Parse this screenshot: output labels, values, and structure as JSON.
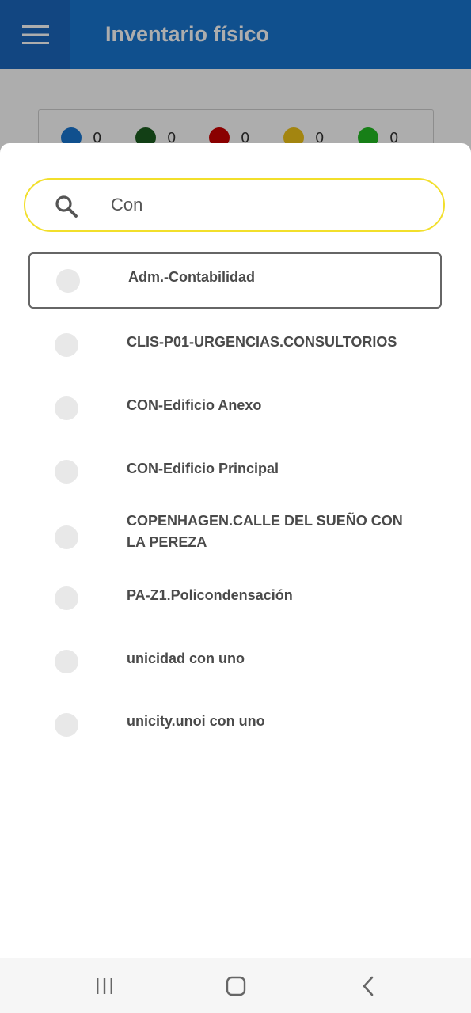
{
  "app_bar": {
    "title": "Inventario físico",
    "menu_icon": "hamburger-menu-icon",
    "color": "#1976d2"
  },
  "status_summary": [
    {
      "color": "#1976d2",
      "count": "0"
    },
    {
      "color": "#1b5e20",
      "count": "0"
    },
    {
      "color": "#cc0000",
      "count": "0"
    },
    {
      "color": "#f0c419",
      "count": "0"
    },
    {
      "color": "#22bb22",
      "count": "0"
    }
  ],
  "search": {
    "value": "Con",
    "icon": "search-icon",
    "border_color": "#f2df2b"
  },
  "locations": [
    {
      "label": "Adm.-Contabilidad",
      "selected": true
    },
    {
      "label": "CLIS-P01-URGENCIAS.CONSULTORIOS",
      "selected": false
    },
    {
      "label": "CON-Edificio Anexo",
      "selected": false
    },
    {
      "label": "CON-Edificio Principal",
      "selected": false
    },
    {
      "label": "COPENHAGEN.CALLE DEL SUEÑO CON LA PEREZA",
      "selected": false
    },
    {
      "label": "PA-Z1.Policondensación",
      "selected": false
    },
    {
      "label": "unicidad con uno",
      "selected": false
    },
    {
      "label": "unicity.unoi con uno",
      "selected": false
    }
  ],
  "nav_bar": {
    "recents_icon": "recents-icon",
    "home_icon": "home-icon",
    "back_icon": "back-icon"
  }
}
